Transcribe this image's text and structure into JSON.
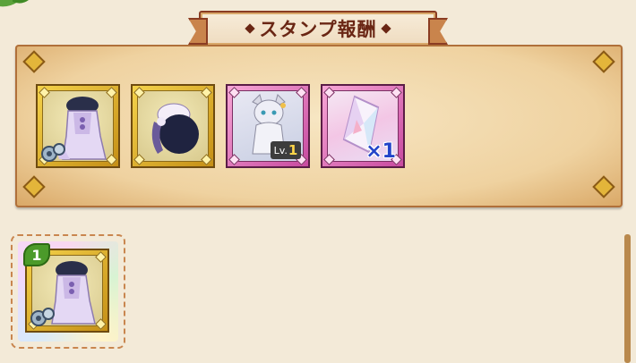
{
  "header": {
    "title": "スタンプ報酬"
  },
  "rewards": [
    {
      "kind": "costume-outfit",
      "frame": "gold",
      "icon": "dress-costume-icon",
      "badge_icon": "gear-badge-icon"
    },
    {
      "kind": "costume-hat",
      "frame": "gold",
      "icon": "dark-hat-icon"
    },
    {
      "kind": "character",
      "frame": "pink",
      "icon": "gray-cat-character-icon",
      "level_prefix": "Lv.",
      "level": "1"
    },
    {
      "kind": "gem",
      "frame": "pink",
      "icon": "crystal-gem-icon",
      "quantity": "×1"
    }
  ],
  "stamp_card": {
    "number": "1",
    "icon": "dress-costume-icon"
  },
  "colors": {
    "title": "#6a2614",
    "gold_frame": "#e3b53a",
    "pink_frame": "#c84aa0",
    "number_leaf": "#4b9a2a",
    "quantity": "#2344c9"
  }
}
